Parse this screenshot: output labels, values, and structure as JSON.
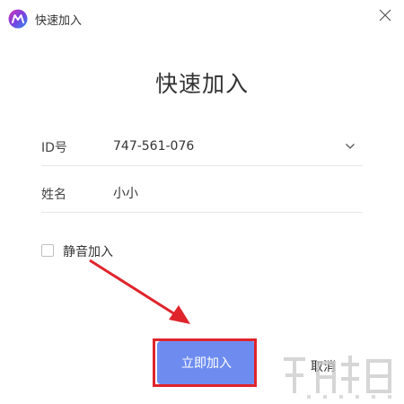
{
  "window": {
    "title": "快速加入",
    "accent_color": "#6e8cf0",
    "annotation_color": "#e0242c"
  },
  "icons": {
    "app_logo": "app-logo-icon",
    "close": "close-icon",
    "dropdown": "chevron-down-icon"
  },
  "form": {
    "heading": "快速加入",
    "id_label": "ID号",
    "id_value": "747-561-076",
    "name_label": "姓名",
    "name_value": "小小",
    "mute_label": "静音加入",
    "mute_checked": false
  },
  "buttons": {
    "join": "立即加入",
    "cancel": "取消"
  }
}
